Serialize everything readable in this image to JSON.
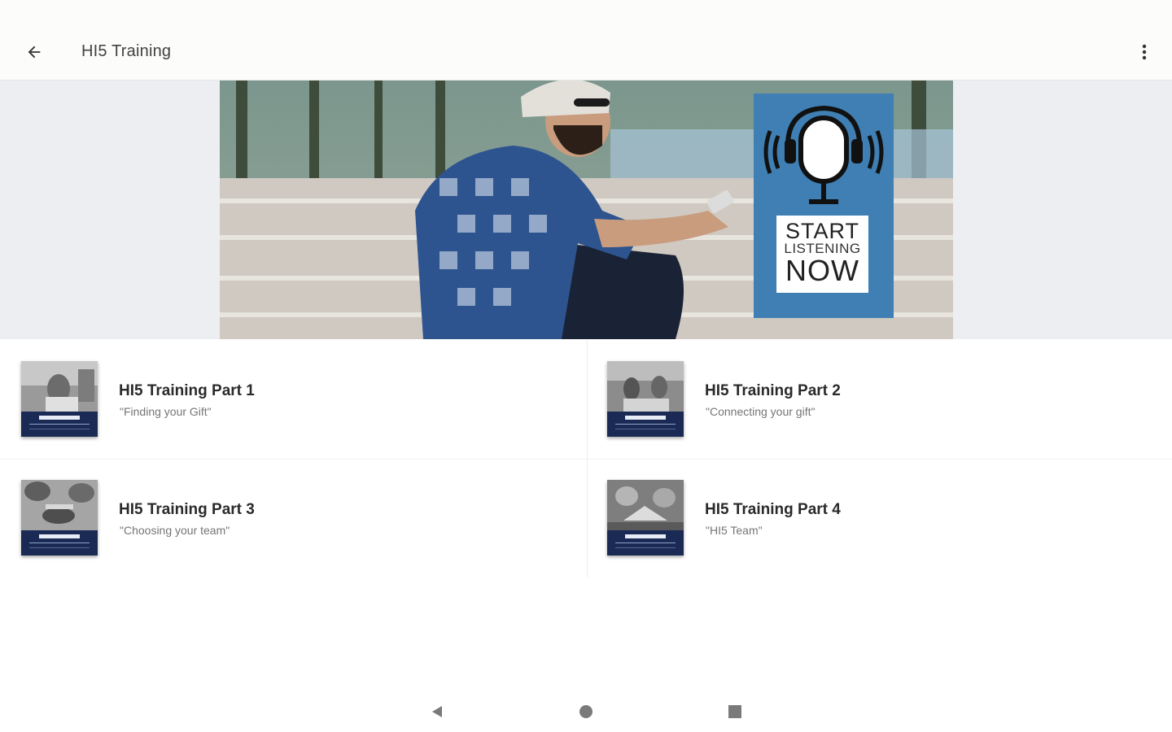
{
  "appbar": {
    "title": "HI5 Training",
    "back_icon": "arrow-back-icon",
    "menu_icon": "more-vert-icon"
  },
  "banner": {
    "line1": "START",
    "line2": "LISTENING",
    "line3": "NOW",
    "accent_color": "#3f7fb3"
  },
  "items": [
    {
      "title": "HI5 Training Part 1",
      "subtitle": "\"Finding your Gift\""
    },
    {
      "title": "HI5 Training Part 2",
      "subtitle": "\"Connecting your gift\""
    },
    {
      "title": "HI5 Training Part 3",
      "subtitle": "\"Choosing your team\""
    },
    {
      "title": "HI5 Training Part 4",
      "subtitle": "\"HI5 Team\""
    }
  ],
  "navbar": {
    "back_icon": "nav-back-triangle-icon",
    "home_icon": "nav-home-circle-icon",
    "recents_icon": "nav-recents-square-icon"
  }
}
